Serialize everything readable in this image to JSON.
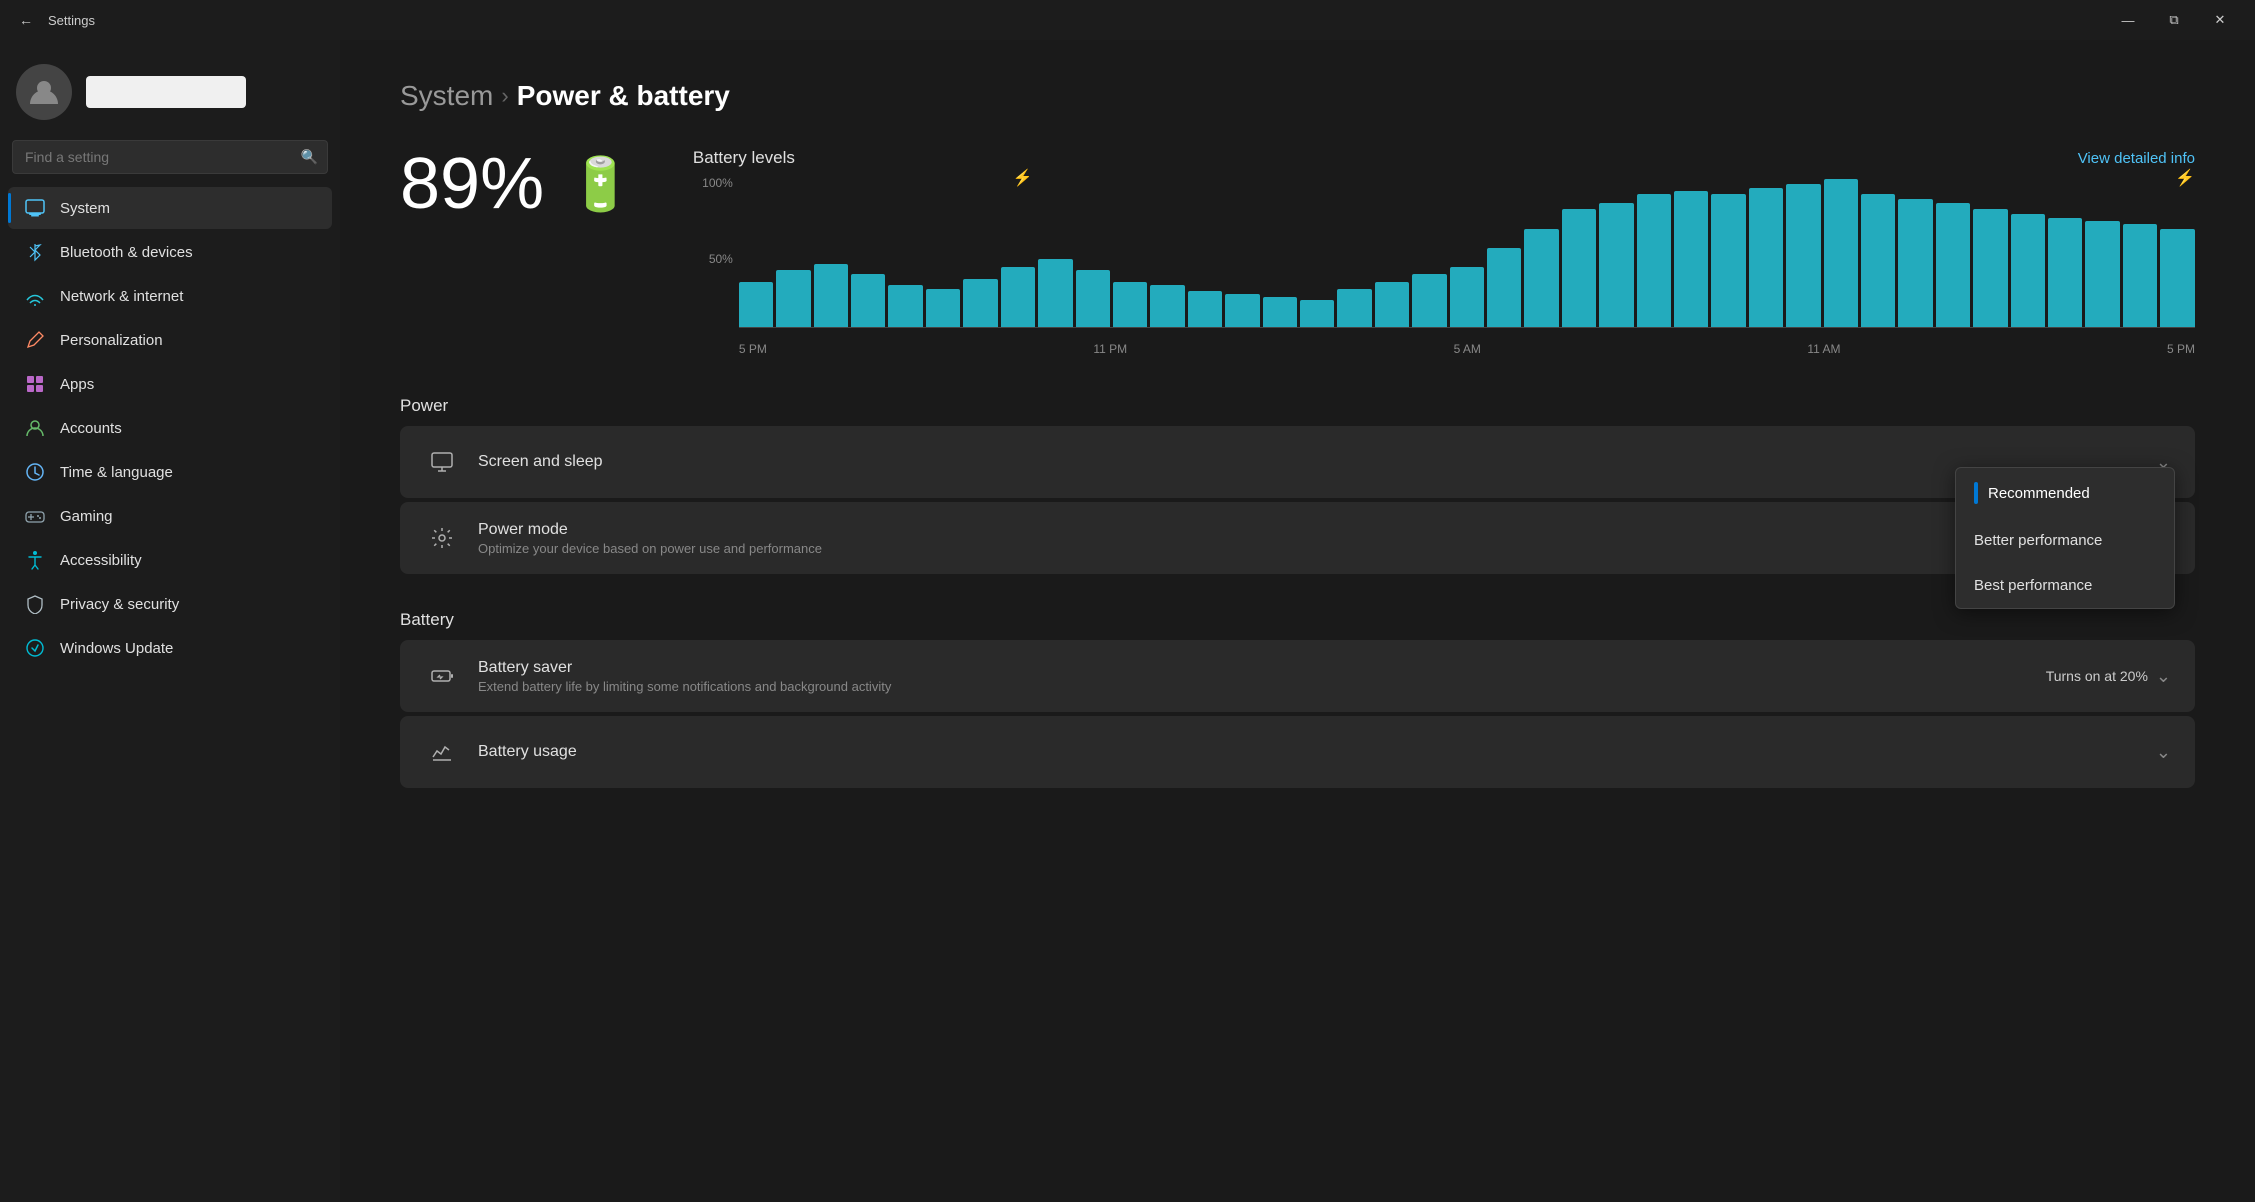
{
  "titlebar": {
    "title": "Settings",
    "back_label": "←",
    "minimize": "—",
    "restore": "⧉",
    "close": "✕"
  },
  "sidebar": {
    "search_placeholder": "Find a setting",
    "username": "",
    "nav_items": [
      {
        "id": "system",
        "label": "System",
        "icon": "system",
        "active": true
      },
      {
        "id": "bluetooth",
        "label": "Bluetooth & devices",
        "icon": "bluetooth",
        "active": false
      },
      {
        "id": "network",
        "label": "Network & internet",
        "icon": "network",
        "active": false
      },
      {
        "id": "personalization",
        "label": "Personalization",
        "icon": "personalization",
        "active": false
      },
      {
        "id": "apps",
        "label": "Apps",
        "icon": "apps",
        "active": false
      },
      {
        "id": "accounts",
        "label": "Accounts",
        "icon": "accounts",
        "active": false
      },
      {
        "id": "time",
        "label": "Time & language",
        "icon": "time",
        "active": false
      },
      {
        "id": "gaming",
        "label": "Gaming",
        "icon": "gaming",
        "active": false
      },
      {
        "id": "accessibility",
        "label": "Accessibility",
        "icon": "accessibility",
        "active": false
      },
      {
        "id": "privacy",
        "label": "Privacy & security",
        "icon": "privacy",
        "active": false
      },
      {
        "id": "update",
        "label": "Windows Update",
        "icon": "update",
        "active": false
      }
    ]
  },
  "content": {
    "breadcrumb_parent": "System",
    "breadcrumb_separator": "›",
    "breadcrumb_current": "Power & battery",
    "battery_percentage": "89%",
    "chart": {
      "title": "Battery levels",
      "view_detailed": "View detailed info",
      "y_labels": [
        "100%",
        "50%"
      ],
      "x_labels": [
        "5 PM",
        "11 PM",
        "5 AM",
        "11 AM",
        "5 PM"
      ],
      "bars": [
        30,
        38,
        42,
        35,
        28,
        25,
        32,
        40,
        45,
        38,
        30,
        28,
        24,
        22,
        20,
        18,
        25,
        30,
        35,
        40,
        52,
        65,
        78,
        82,
        88,
        90,
        88,
        92,
        95,
        98,
        88,
        85,
        82,
        78,
        75,
        72,
        70,
        68,
        65
      ]
    },
    "power_section_label": "Power",
    "screen_sleep_label": "Screen and sleep",
    "power_mode_label": "Power mode",
    "power_mode_subtitle": "Optimize your device based on power use and performance",
    "power_mode_dropdown": {
      "options": [
        {
          "label": "Recommended",
          "selected": true
        },
        {
          "label": "Better performance",
          "selected": false
        },
        {
          "label": "Best performance",
          "selected": false
        }
      ]
    },
    "battery_section_label": "Battery",
    "battery_saver_label": "Battery saver",
    "battery_saver_subtitle": "Extend battery life by limiting some notifications and background activity",
    "battery_saver_turns_on": "Turns on at 20%",
    "battery_usage_label": "Battery usage"
  }
}
